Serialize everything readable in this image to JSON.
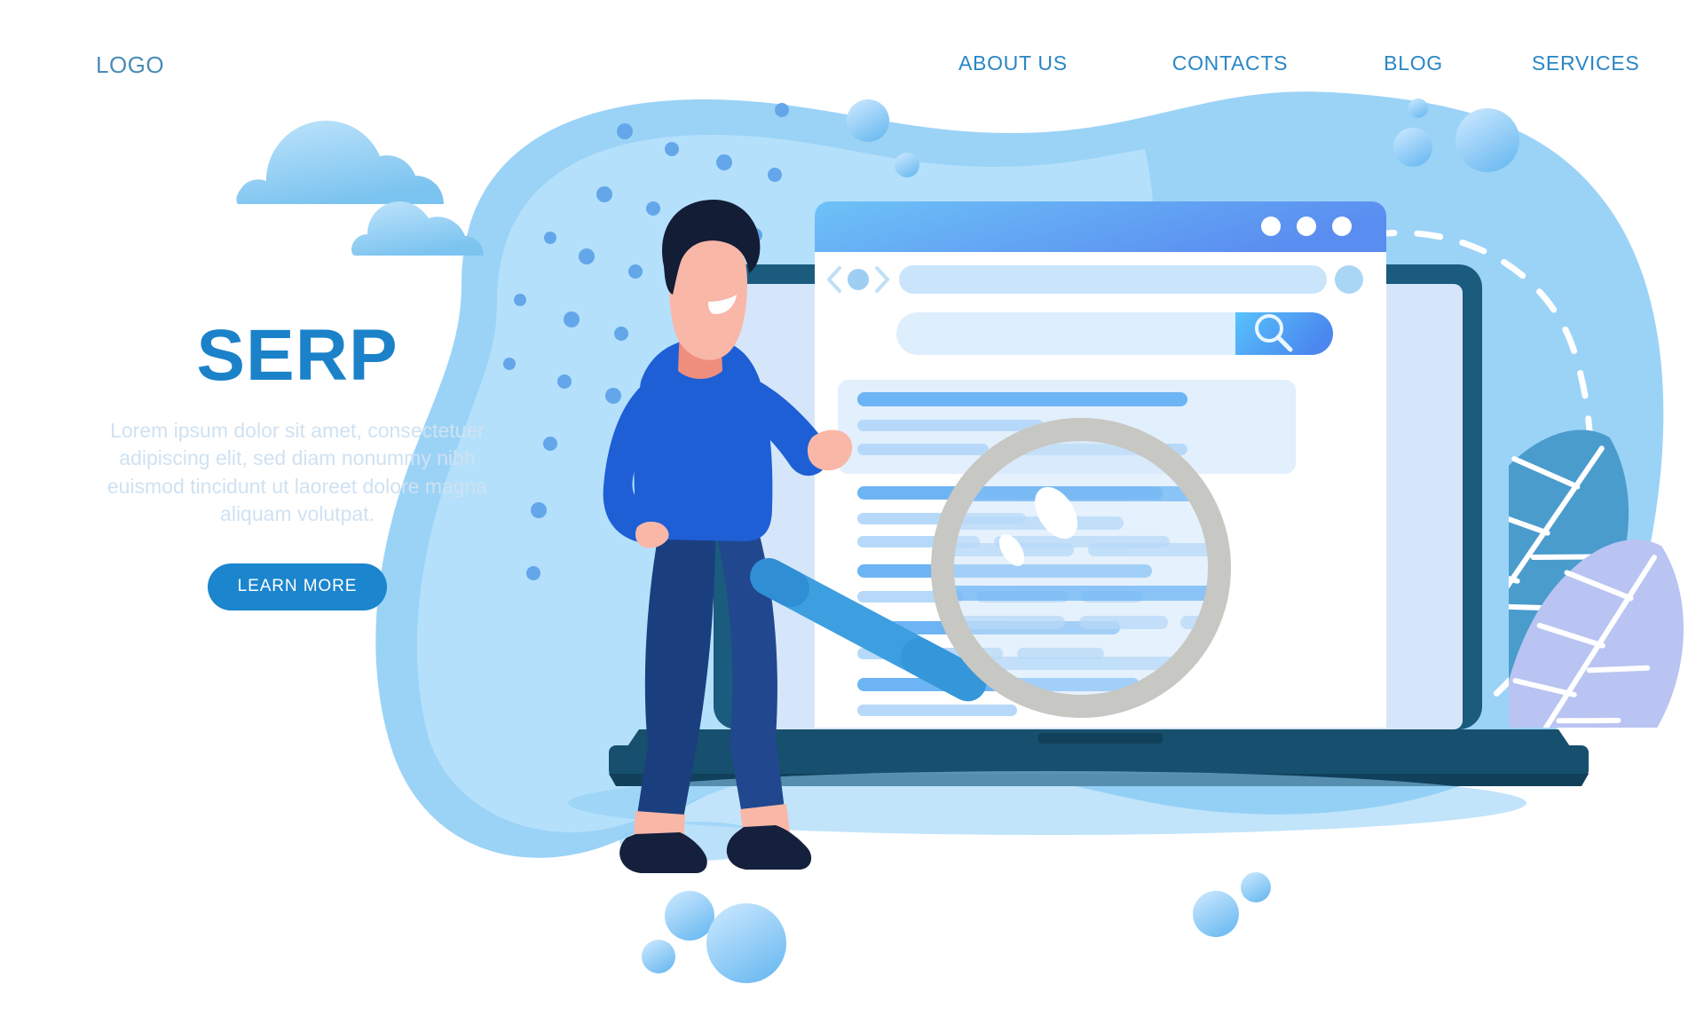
{
  "header": {
    "logo": "LOGO",
    "nav": [
      {
        "label": "ABOUT US"
      },
      {
        "label": "CONTACTS"
      },
      {
        "label": "BLOG"
      },
      {
        "label": "SERVICES"
      }
    ]
  },
  "hero": {
    "title": "SERP",
    "subtitle": "Lorem ipsum dolor sit amet, consectetuer adipiscing elit, sed diam nonummy nibh euismod tincidunt ut laoreet dolore magna aliquam volutpat.",
    "cta_label": "LEARN MORE"
  },
  "illustration": {
    "browser": {
      "titlebar_dots": 3,
      "nav_icons": [
        "chevron-left-icon",
        "circle-icon",
        "chevron-right-icon"
      ],
      "url_bar_value": "",
      "refresh_icon": "refresh-icon",
      "search_input_value": "",
      "search_button_icon": "magnifier-icon",
      "results": [
        {
          "title_width": 340,
          "lines": [
            200,
            130,
            120
          ]
        },
        {
          "title_width": 330,
          "lines": [
            175,
            130,
            105,
            90
          ]
        },
        {
          "title_width": 300,
          "lines": [
            90,
            110,
            80,
            120
          ]
        },
        {
          "title_width": 250,
          "lines": [
            150,
            95
          ]
        }
      ]
    },
    "magnifier": {
      "lens_icon": "magnifier-lens",
      "handle_color": "#3d9fe0",
      "ring_color": "#c7c7c3"
    },
    "character": {
      "hair_color": "#141d36",
      "skin_color": "#f5a091",
      "shirt_color": "#1f5fd6",
      "pants_color": "#1b3f7e",
      "shoe_color": "#15203d"
    },
    "colors": {
      "blob": "#9bd3f7",
      "blob_light": "#bfe5fa",
      "laptop_frame": "#1a5b7e",
      "laptop_base": "#17506e",
      "accent_blue": "#1b85cd",
      "dot_blue": "#63a6ea",
      "leaf_dark": "#4a9ccd",
      "leaf_light": "#b9c4f2",
      "cloud": "#9fd5f8"
    }
  }
}
